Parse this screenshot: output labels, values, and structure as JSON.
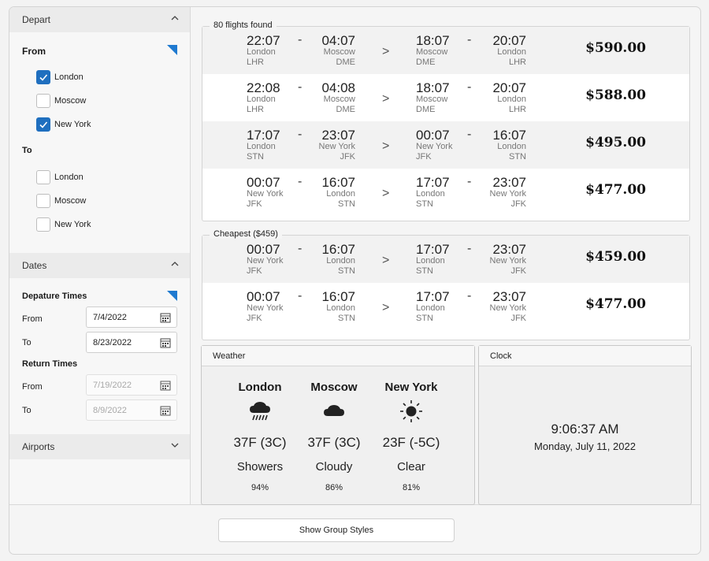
{
  "sidebar": {
    "depart": {
      "header": "Depart",
      "from_label": "From",
      "from_items": [
        {
          "label": "London",
          "checked": true
        },
        {
          "label": "Moscow",
          "checked": false
        },
        {
          "label": "New York",
          "checked": true
        }
      ],
      "to_label": "To",
      "to_items": [
        {
          "label": "London",
          "checked": false
        },
        {
          "label": "Moscow",
          "checked": false
        },
        {
          "label": "New York",
          "checked": false
        }
      ]
    },
    "dates": {
      "header": "Dates",
      "departure_label": "Depature Times",
      "dep_from_label": "From",
      "dep_from_value": "7/4/2022",
      "dep_to_label": "To",
      "dep_to_value": "8/23/2022",
      "return_label": "Return Times",
      "ret_from_label": "From",
      "ret_from_value": "7/19/2022",
      "ret_to_label": "To",
      "ret_to_value": "8/9/2022"
    },
    "airports": {
      "header": "Airports"
    },
    "accent_color": "#1f7ad0"
  },
  "flights": {
    "title": "80 flights found",
    "rows": [
      {
        "d1": "22:07",
        "c1": "London",
        "a1": "LHR",
        "d2": "04:07",
        "c2": "Moscow",
        "a2": "DME",
        "r1": "18:07",
        "rc1": "Moscow",
        "ra1": "DME",
        "r2": "20:07",
        "rc2": "London",
        "ra2": "LHR",
        "price": "$590.00"
      },
      {
        "d1": "22:08",
        "c1": "London",
        "a1": "LHR",
        "d2": "04:08",
        "c2": "Moscow",
        "a2": "DME",
        "r1": "18:07",
        "rc1": "Moscow",
        "ra1": "DME",
        "r2": "20:07",
        "rc2": "London",
        "ra2": "LHR",
        "price": "$588.00"
      },
      {
        "d1": "17:07",
        "c1": "London",
        "a1": "STN",
        "d2": "23:07",
        "c2": "New York",
        "a2": "JFK",
        "r1": "00:07",
        "rc1": "New York",
        "ra1": "JFK",
        "r2": "16:07",
        "rc2": "London",
        "ra2": "STN",
        "price": "$495.00"
      },
      {
        "d1": "00:07",
        "c1": "New York",
        "a1": "JFK",
        "d2": "16:07",
        "c2": "London",
        "a2": "STN",
        "r1": "17:07",
        "rc1": "London",
        "ra1": "STN",
        "r2": "23:07",
        "rc2": "New York",
        "ra2": "JFK",
        "price": "$477.00"
      }
    ]
  },
  "cheapest": {
    "title": "Cheapest ($459)",
    "rows": [
      {
        "d1": "00:07",
        "c1": "New York",
        "a1": "JFK",
        "d2": "16:07",
        "c2": "London",
        "a2": "STN",
        "r1": "17:07",
        "rc1": "London",
        "ra1": "STN",
        "r2": "23:07",
        "rc2": "New York",
        "ra2": "JFK",
        "price": "$459.00"
      },
      {
        "d1": "00:07",
        "c1": "New York",
        "a1": "JFK",
        "d2": "16:07",
        "c2": "London",
        "a2": "STN",
        "r1": "17:07",
        "rc1": "London",
        "ra1": "STN",
        "r2": "23:07",
        "rc2": "New York",
        "ra2": "JFK",
        "price": "$477.00"
      }
    ]
  },
  "separators": {
    "dash": "-",
    "arrow": ">"
  },
  "weather": {
    "title": "Weather",
    "cities": [
      {
        "city": "London",
        "icon": "rain-cloud-icon",
        "temp": "37F (3C)",
        "cond": "Showers",
        "humidity": "94%"
      },
      {
        "city": "Moscow",
        "icon": "cloud-icon",
        "temp": "37F (3C)",
        "cond": "Cloudy",
        "humidity": "86%"
      },
      {
        "city": "New York",
        "icon": "sun-icon",
        "temp": "23F (-5C)",
        "cond": "Clear",
        "humidity": "81%"
      }
    ]
  },
  "clock": {
    "title": "Clock",
    "time": "9:06:37 AM",
    "date": "Monday, July 11, 2022"
  },
  "footer": {
    "button_label": "Show Group Styles"
  }
}
